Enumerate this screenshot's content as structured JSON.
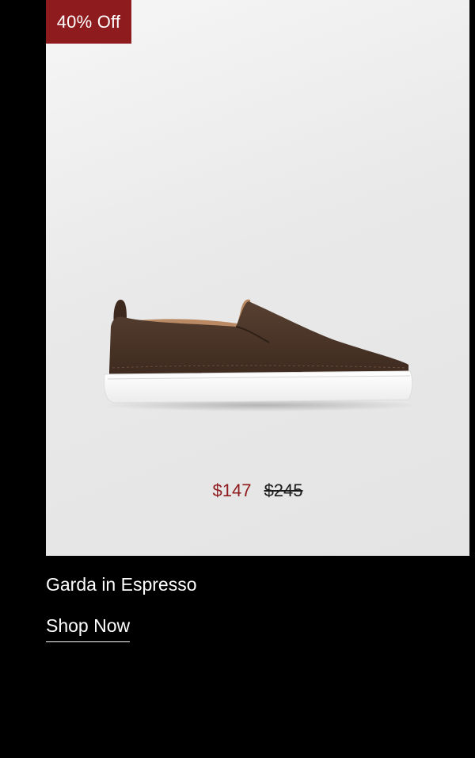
{
  "product": {
    "badge": "40% Off",
    "sale_price": "$147",
    "original_price": "$245",
    "name": "Garda in Espresso",
    "image_subject": "espresso suede slip-on sneaker",
    "cta_label": "Shop Now"
  },
  "colors": {
    "page_background": "#000000",
    "badge_background": "#8e1b1d",
    "sale_price": "#8e1b1d",
    "upper": "#4a3326",
    "sole": "#ffffff"
  }
}
